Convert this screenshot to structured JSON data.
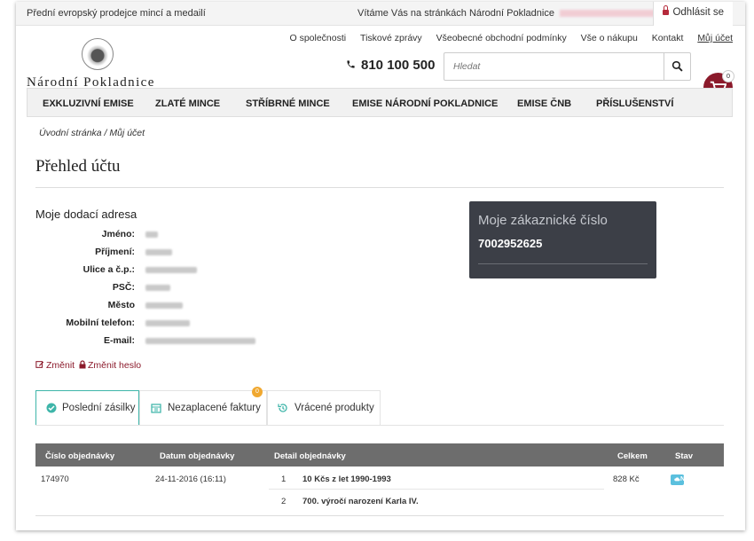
{
  "topbar": {
    "slogan": "Přední evropský prodejce mincí a medailí",
    "welcome": "Vítáme Vás na stránkách Národní Pokladnice",
    "logout": "Odhlásit se"
  },
  "header": {
    "logo_name": "Národní Pokladnice",
    "links": [
      "O společnosti",
      "Tiskové zprávy",
      "Všeobecné obchodní podmínky",
      "Vše o nákupu",
      "Kontakt",
      "Můj účet"
    ],
    "phone": "810 100 500",
    "search_placeholder": "Hledat",
    "cart_count": "0"
  },
  "nav": [
    "EXKLUZIVNÍ EMISE",
    "ZLATÉ MINCE",
    "STŘÍBRNÉ MINCE",
    "EMISE NÁRODNÍ POKLADNICE",
    "EMISE ČNB",
    "PŘÍSLUŠENSTVÍ"
  ],
  "breadcrumb": "Úvodní stránka  /  Můj účet",
  "page_title": "Přehled účtu",
  "address": {
    "heading": "Moje dodací adresa",
    "labels": [
      "Jméno:",
      "Příjmení:",
      "Ulice a č.p.:",
      "PSČ:",
      "Město",
      "Mobilní telefon:",
      "E-mail:"
    ]
  },
  "customer": {
    "title": "Moje zákaznické číslo",
    "number": "7002952625"
  },
  "actions": {
    "change": "Změnit",
    "change_password": "Změnit heslo"
  },
  "tabs": {
    "items": [
      "Poslední zásilky",
      "Nezaplacené faktury",
      "Vrácené produkty"
    ],
    "badge": "0"
  },
  "orders": {
    "headers": [
      "Číslo objednávky",
      "Datum objednávky",
      "Detail objednávky",
      "Celkem",
      "Stav"
    ],
    "rows": [
      {
        "number": "174970",
        "date": "24-11-2016 (16:11)",
        "items": [
          {
            "qty": "1",
            "name": "10 Kčs z let 1990-1993"
          },
          {
            "qty": "2",
            "name": "700. výročí narození Karla IV."
          }
        ],
        "total": "828 Kč",
        "status": "Nový"
      }
    ]
  }
}
